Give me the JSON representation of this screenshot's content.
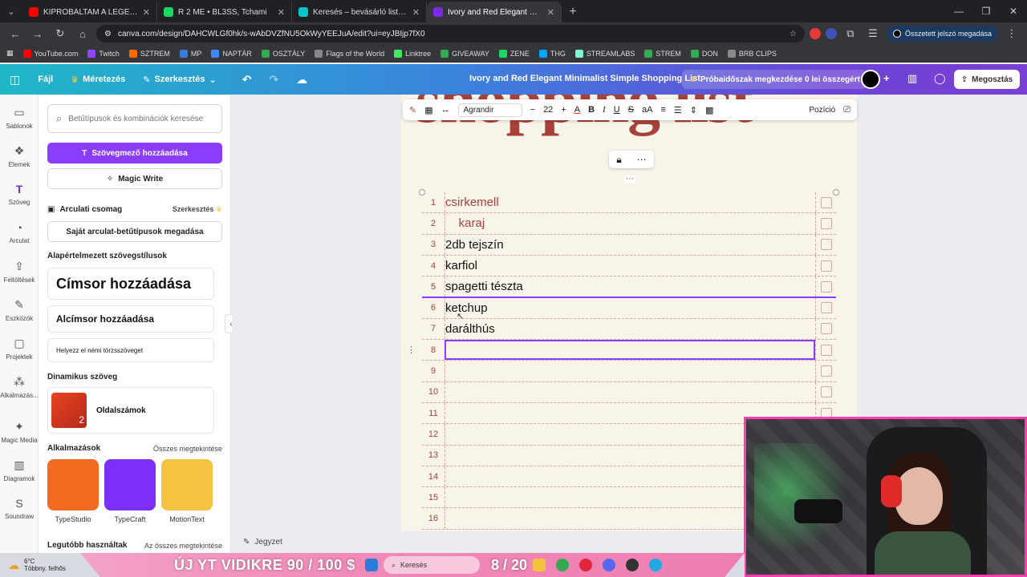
{
  "browser": {
    "tabs": [
      {
        "title": "KIPRÓBÁLTAM A LEGENDÁS KÁ",
        "color": "#ff0000",
        "active": false
      },
      {
        "title": "R 2 ME • BL3SS, Tchami",
        "color": "#1ed760",
        "active": false
      },
      {
        "title": "Keresés – bevásárló lista – Canv",
        "color": "#00c4cc",
        "active": false
      },
      {
        "title": "Ivory and Red Elegant Minimalis",
        "color": "#7d2ae8",
        "active": true
      }
    ],
    "url": "canva.com/design/DAHCWLGf0hk/s-wAbDVZfNU5OkWyYEEJuA/edit?ui=eyJBIjp7fX0",
    "password_button": "Összetett jelszó megadása",
    "bookmarks": [
      {
        "label": "YouTube.com",
        "color": "#ff0000"
      },
      {
        "label": "Twitch",
        "color": "#9146ff"
      },
      {
        "label": "SZTREM",
        "color": "#ff6a00"
      },
      {
        "label": "MP",
        "color": "#3a7bd5"
      },
      {
        "label": "NAPTÁR",
        "color": "#4285f4"
      },
      {
        "label": "OSZTÁLY",
        "color": "#34a853"
      },
      {
        "label": "Flags of the World",
        "color": "#888888"
      },
      {
        "label": "Linktree",
        "color": "#43e660"
      },
      {
        "label": "GIVEAWAY",
        "color": "#34a853"
      },
      {
        "label": "ZENE",
        "color": "#1ed760"
      },
      {
        "label": "THG",
        "color": "#00a6ff"
      },
      {
        "label": "STREAMLABS",
        "color": "#80f5d2"
      },
      {
        "label": "STREM",
        "color": "#34a853"
      },
      {
        "label": "DON",
        "color": "#34a853"
      },
      {
        "label": "BRB CLIPS",
        "color": "#888888"
      }
    ]
  },
  "header": {
    "file": "Fájl",
    "resize": "Méretezés",
    "edit": "Szerkesztés",
    "title": "Ivory and Red Elegant Minimalist Simple Shopping List",
    "trial": "Próbaidőszak megkezdése 0 lei összegért",
    "share": "Megosztás"
  },
  "rail": [
    {
      "label": "Sablonok",
      "icon": "▭"
    },
    {
      "label": "Elemek",
      "icon": "❖"
    },
    {
      "label": "Szöveg",
      "icon": "T"
    },
    {
      "label": "Arculat",
      "icon": "◔"
    },
    {
      "label": "Feltöltések",
      "icon": "⇪"
    },
    {
      "label": "Eszközök",
      "icon": "✎"
    },
    {
      "label": "Projektek",
      "icon": "▢"
    },
    {
      "label": "Alkalmazás...",
      "icon": "⁂"
    },
    {
      "label": "Magic Media",
      "icon": "✦"
    },
    {
      "label": "Diagramok",
      "icon": "▥"
    },
    {
      "label": "Soundraw",
      "icon": "S"
    }
  ],
  "panel": {
    "search_placeholder": "Betűtípusok és kombinációk keresése",
    "add_textbox": "Szövegmező hozzáadása",
    "magic_write": "Magic Write",
    "brand_kit": "Arculati csomag",
    "brand_edit": "Szerkesztés",
    "brand_fonts": "Saját arculat-betűtípusok megadása",
    "default_styles": "Alapértelmezett szövegstílusok",
    "heading": "Címsor hozzáadása",
    "subheading": "Alcímsor hozzáadása",
    "body": "Helyezz el némi törzsszöveget",
    "dynamic": "Dinamikus szöveg",
    "page_numbers": "Oldalszámok",
    "apps": "Alkalmazások",
    "see_all": "Összes megtekintése",
    "app_tiles": [
      {
        "label": "TypeStudio",
        "color": "#f26b21"
      },
      {
        "label": "TypeCraft",
        "color": "#7b2ff7"
      },
      {
        "label": "MotionText",
        "color": "#f5c242"
      }
    ],
    "recent": "Legutóbb használtak",
    "recent_all": "Az összes megtekintése"
  },
  "toolbar": {
    "font": "Agrandir",
    "size": "22",
    "position": "Pozíció"
  },
  "canvas": {
    "title_text": "shopping list",
    "rows": [
      {
        "num": "1",
        "text": "csirkemell",
        "faded": true
      },
      {
        "num": "2",
        "text": "    karaj",
        "faded": true
      },
      {
        "num": "3",
        "text": "2db tejszín",
        "faded": false
      },
      {
        "num": "4",
        "text": "karfiol",
        "faded": false
      },
      {
        "num": "5",
        "text": "spagetti tészta",
        "faded": false
      },
      {
        "num": "6",
        "text": "ketchup",
        "faded": false
      },
      {
        "num": "7",
        "text": "darálthús",
        "faded": false
      },
      {
        "num": "8",
        "text": "",
        "faded": false
      },
      {
        "num": "9",
        "text": "",
        "faded": false
      },
      {
        "num": "10",
        "text": "",
        "faded": false
      },
      {
        "num": "11",
        "text": "",
        "faded": false
      },
      {
        "num": "12",
        "text": "",
        "faded": false
      },
      {
        "num": "13",
        "text": "",
        "faded": false
      },
      {
        "num": "14",
        "text": "",
        "faded": false
      },
      {
        "num": "15",
        "text": "",
        "faded": false
      },
      {
        "num": "16",
        "text": "",
        "faded": false
      }
    ],
    "selected_row": "8",
    "notes": "Jegyzet"
  },
  "taskbar": {
    "temp": "6°C",
    "weather": "Többny. felhős",
    "banner": "ÚJ YT VIDIKRE 90 / 100 $",
    "search": "Keresés",
    "count": "8 / 20"
  }
}
